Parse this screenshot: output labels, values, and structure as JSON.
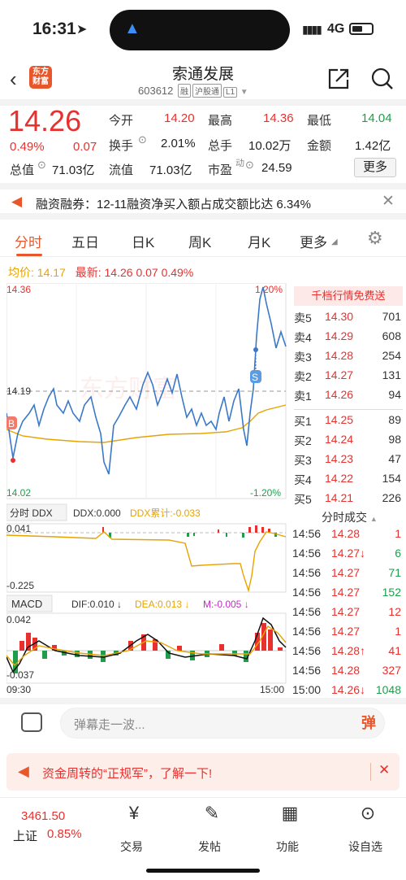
{
  "status": {
    "time": "16:31",
    "network": "4G"
  },
  "header": {
    "title": "索通发展",
    "code": "603612",
    "tags": [
      "融",
      "沪股通",
      "L1"
    ]
  },
  "quote": {
    "price": "14.26",
    "change_pct": "0.49%",
    "change": "0.07",
    "open_label": "今开",
    "open": "14.20",
    "high_label": "最高",
    "high": "14.36",
    "low_label": "最低",
    "low": "14.04",
    "turnover_label": "换手",
    "turnover": "2.01%",
    "volume_label": "总手",
    "volume": "10.02万",
    "amount_label": "金额",
    "amount": "1.42亿",
    "mktcap_label": "总值",
    "mktcap": "71.03亿",
    "float_label": "流值",
    "float": "71.03亿",
    "pe_label": "市盈",
    "pe_sup": "动",
    "pe": "24.59",
    "more": "更多"
  },
  "news": {
    "text": "融资融券：12-11融资净买入额占成交额比达 6.34%"
  },
  "tabs": [
    "分时",
    "五日",
    "日K",
    "周K",
    "月K",
    "更多"
  ],
  "price_bar": {
    "avg_label": "均价:",
    "avg": "14.17",
    "latest_label": "最新:",
    "latest": "14.26",
    "change": "0.07",
    "pct": "0.49%"
  },
  "chart": {
    "y_top": "14.36",
    "y_mid": "14.19",
    "y_bot": "14.02",
    "pct_top": "1.20%",
    "pct_bot": "-1.20%",
    "watermark": "东方财富",
    "buy_marker": "B",
    "sell_marker": "S",
    "x_start": "09:30",
    "x_end": "15:00"
  },
  "ddx": {
    "tab": "分时 DDX",
    "ddx_label": "DDX:0.000",
    "ddx_sum": "DDX累计:-0.033",
    "top": "0.041",
    "bot": "-0.225"
  },
  "macd": {
    "tab": "MACD",
    "dif": "DIF:0.010 ↓",
    "dea": "DEA:0.013 ↓",
    "m": "M:-0.005 ↓",
    "top": "0.042",
    "bot": "-0.037"
  },
  "orderbook": {
    "title": "千档行情免费送",
    "asks": [
      {
        "label": "卖5",
        "price": "14.30",
        "vol": "701"
      },
      {
        "label": "卖4",
        "price": "14.29",
        "vol": "608"
      },
      {
        "label": "卖3",
        "price": "14.28",
        "vol": "254"
      },
      {
        "label": "卖2",
        "price": "14.27",
        "vol": "131"
      },
      {
        "label": "卖1",
        "price": "14.26",
        "vol": "94"
      }
    ],
    "bids": [
      {
        "label": "买1",
        "price": "14.25",
        "vol": "89"
      },
      {
        "label": "买2",
        "price": "14.24",
        "vol": "98"
      },
      {
        "label": "买3",
        "price": "14.23",
        "vol": "47"
      },
      {
        "label": "买4",
        "price": "14.22",
        "vol": "154"
      },
      {
        "label": "买5",
        "price": "14.21",
        "vol": "226"
      }
    ]
  },
  "trades": {
    "title": "分时成交",
    "rows": [
      {
        "time": "14:56",
        "price": "14.28",
        "vol": "1",
        "pc": "red",
        "vc": "red"
      },
      {
        "time": "14:56",
        "price": "14.27↓",
        "vol": "6",
        "pc": "red",
        "vc": "green"
      },
      {
        "time": "14:56",
        "price": "14.27",
        "vol": "71",
        "pc": "red",
        "vc": "green"
      },
      {
        "time": "14:56",
        "price": "14.27",
        "vol": "152",
        "pc": "red",
        "vc": "green"
      },
      {
        "time": "14:56",
        "price": "14.27",
        "vol": "12",
        "pc": "red",
        "vc": "red"
      },
      {
        "time": "14:56",
        "price": "14.27",
        "vol": "1",
        "pc": "red",
        "vc": "red"
      },
      {
        "time": "14:56",
        "price": "14.28↑",
        "vol": "41",
        "pc": "red",
        "vc": "red"
      },
      {
        "time": "14:56",
        "price": "14.28",
        "vol": "327",
        "pc": "red",
        "vc": "red"
      },
      {
        "time": "15:00",
        "price": "14.26↓",
        "vol": "1048",
        "pc": "red",
        "vc": "green"
      }
    ]
  },
  "comment": {
    "placeholder": "弹幕走一波...",
    "btn": "弹"
  },
  "promo": {
    "text": "资金周转的“正规军”，了解一下!"
  },
  "nav": {
    "index_value": "3461.50",
    "index_name": "上证",
    "index_pct": "0.85%",
    "items": [
      "交易",
      "发帖",
      "功能",
      "设自选"
    ]
  }
}
